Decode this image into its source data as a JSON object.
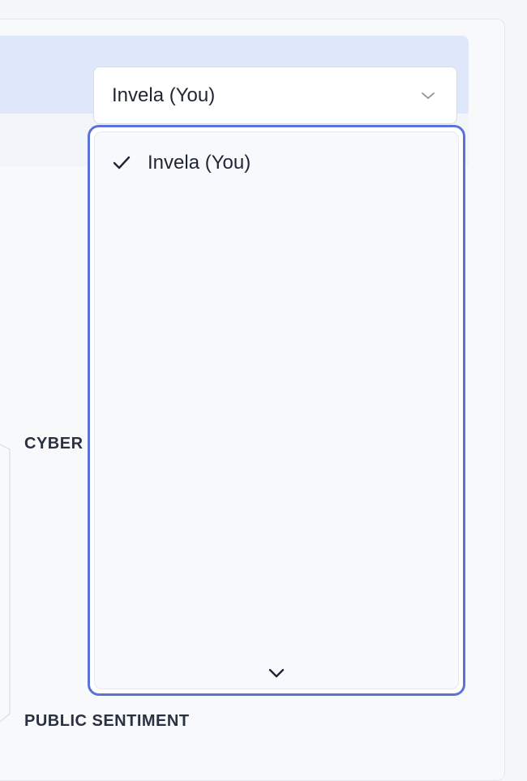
{
  "selector": {
    "selected_value": "Invela (You)"
  },
  "dropdown": {
    "options": [
      {
        "label": "Invela (You)",
        "selected": true
      }
    ]
  },
  "chart_labels": {
    "cyber": "CYBER",
    "public_sentiment": "PUBLIC SENTIMENT"
  },
  "colors": {
    "accent": "#5b73d8",
    "header_band": "#dfe8fa",
    "text": "#1f2633"
  }
}
